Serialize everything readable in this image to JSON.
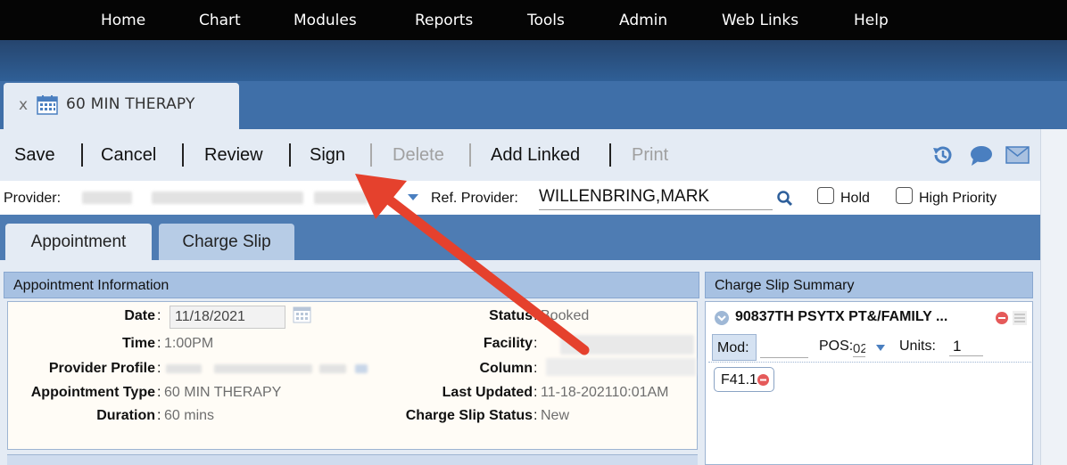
{
  "nav": {
    "items": [
      "Home",
      "Chart",
      "Modules",
      "Reports",
      "Tools",
      "Admin",
      "Web Links",
      "Help"
    ]
  },
  "doc_tab": {
    "close": "x",
    "title": "60 MIN THERAPY"
  },
  "toolbar": {
    "save": "Save",
    "cancel": "Cancel",
    "review": "Review",
    "sign": "Sign",
    "delete": "Delete",
    "add_linked": "Add Linked",
    "print": "Print",
    "icons": [
      "history-icon",
      "chat-bubble-icon",
      "mail-icon"
    ]
  },
  "provider_row": {
    "provider_label": "Provider:",
    "ref_provider_label": "Ref. Provider:",
    "ref_provider_value": "WILLENBRING,MARK",
    "hold_label": "Hold",
    "high_priority_label": "High Priority"
  },
  "tabs": {
    "appointment": "Appointment",
    "charge_slip": "Charge Slip"
  },
  "appointment_info": {
    "header": "Appointment Information",
    "date_label": "Date",
    "date_value": "11/18/2021",
    "time_label": "Time",
    "time_value": "1:00PM",
    "provider_profile_label": "Provider Profile",
    "appointment_type_label": "Appointment Type",
    "appointment_type_value": "60 MIN THERAPY",
    "duration_label": "Duration",
    "duration_value": "60 mins",
    "status_label": "Status",
    "status_value": "Booked",
    "facility_label": "Facility",
    "column_label": "Column",
    "last_updated_label": "Last Updated",
    "last_updated_value": "11-18-202110:01AM",
    "charge_slip_status_label": "Charge Slip Status",
    "charge_slip_status_value": "New",
    "separator": ":"
  },
  "charge_slip_summary": {
    "header": "Charge Slip Summary",
    "procedure": "90837TH PSYTX PT&/FAMILY ...",
    "mod_label": "Mod:",
    "pos_label": "POS:",
    "pos_value": "02",
    "units_label": "Units:",
    "units_value": "1",
    "diagnosis_code": "F41.1"
  },
  "colors": {
    "nav_bg": "#050505",
    "band": "#2f5f96",
    "tabstrip": "#3f6fa8",
    "panel_header": "#a7c1e2",
    "annotation_arrow": "#e5412d"
  }
}
